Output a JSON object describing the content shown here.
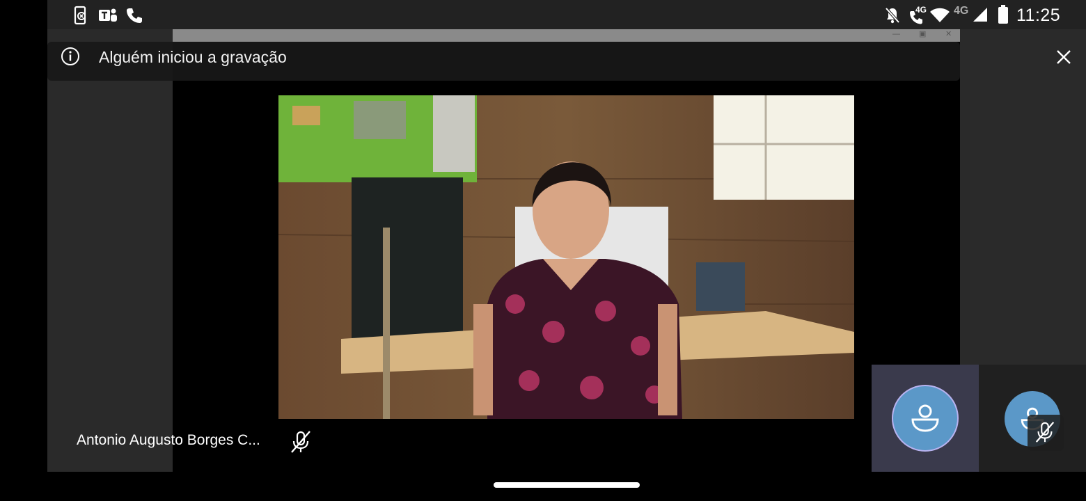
{
  "status_bar": {
    "time": "11:25",
    "left_icons": [
      "phone-link-icon",
      "teams-icon",
      "phone-icon"
    ],
    "right_icons": [
      "notifications-off-icon",
      "volte-call-icon",
      "wifi-icon",
      "signal-icon",
      "battery-icon"
    ],
    "volte_label": "4G",
    "network_label": "4G"
  },
  "banner": {
    "icon": "info-icon",
    "text": "Alguém iniciou a gravação",
    "close_icon": "close-icon"
  },
  "main_participant": {
    "name": "Antonio Augusto Borges C...",
    "mic_icon": "mic-off-icon"
  },
  "tiles": [
    {
      "icon": "avatar-icon",
      "state": "self"
    },
    {
      "icon": "avatar-icon",
      "overlay_icon": "mic-off-icon"
    }
  ],
  "colors": {
    "avatar": "#5b98c8",
    "avatar_ring": "#b8b3f0",
    "banner_bg": "#181818",
    "self_tile_bg": "#3a3a4c"
  }
}
